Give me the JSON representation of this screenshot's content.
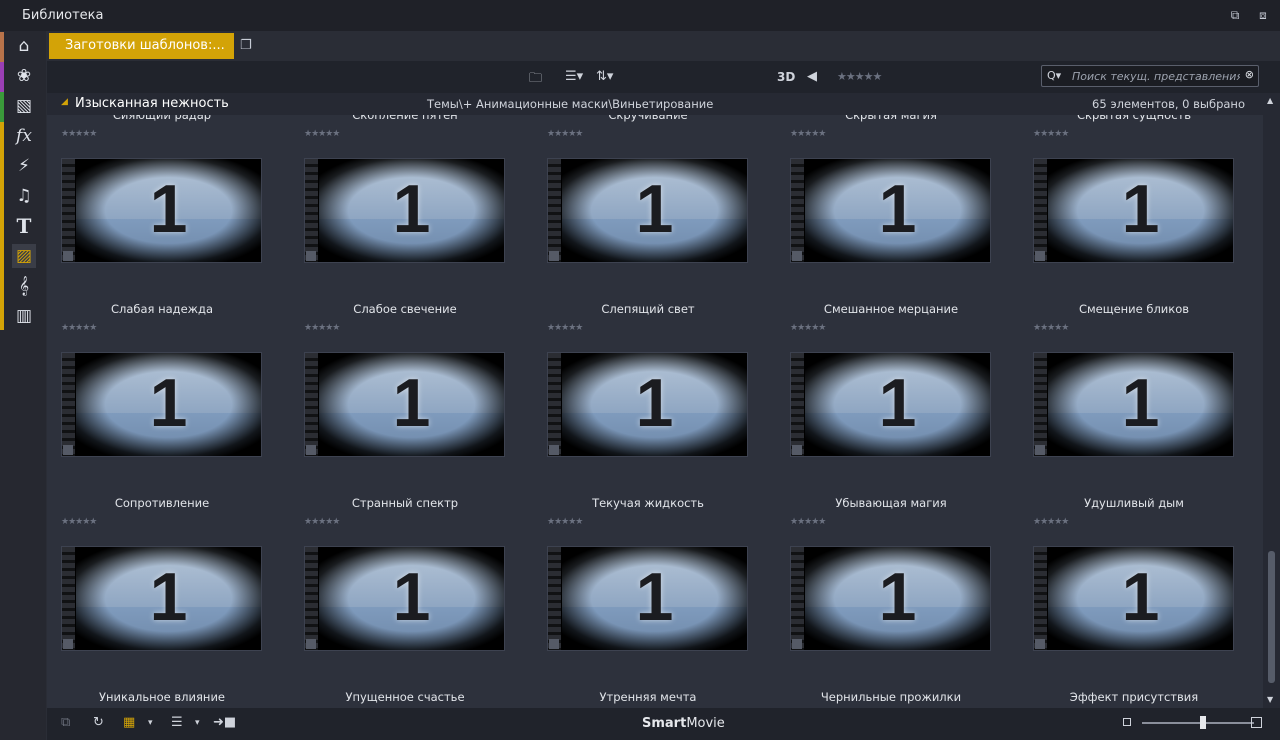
{
  "window": {
    "title": "Библиотека",
    "restore_icon": "restore-window-icon",
    "detach_icon": "detach-window-icon"
  },
  "leftbar": {
    "items": [
      {
        "icon": "project-bin-icon",
        "color": "#b8734a"
      },
      {
        "icon": "film-reel-icon",
        "color": "#9a3fb5"
      },
      {
        "icon": "transitions-icon",
        "color": "#3a9a3a"
      },
      {
        "icon": "fx-icon",
        "color": "#d3a307"
      },
      {
        "icon": "flash-icon",
        "color": "#d3a307"
      },
      {
        "icon": "music-note-icon",
        "color": "#d3a307"
      },
      {
        "icon": "title-text-icon",
        "color": "#d3a307"
      },
      {
        "icon": "montage-templates-icon",
        "color": "#d3a307"
      },
      {
        "icon": "scorefitter-icon",
        "color": "#d3a307"
      },
      {
        "icon": "piano-icon",
        "color": "#d3a307"
      }
    ]
  },
  "tabs": {
    "active_label": "Заготовки шаблонов:...",
    "active_color": "#d3a307"
  },
  "toolbar": {
    "mode_3d": "3D",
    "search_placeholder": "Поиск текущ. представления"
  },
  "header": {
    "collection": "Изысканная нежность",
    "path": "Темы\\+ Анимационные маски\\Виньетирование",
    "count": "65 элементов, 0 выбрано"
  },
  "rows": [
    {
      "top_labels": [
        "Сияющий радар",
        "Скопление пятен",
        "Скручивание",
        "Скрытая магия",
        "Скрытая сущность"
      ],
      "bottom_labels": [
        "Слабая надежда",
        "Слабое свечение",
        "Слепящий свет",
        "Смешанное мерцание",
        "Смещение бликов"
      ]
    },
    {
      "top_labels": [
        "Слабая надежда",
        "Слабое свечение",
        "Слепящий свет",
        "Смешанное мерцание",
        "Смещение бликов"
      ],
      "bottom_labels": [
        "Сопротивление",
        "Странный спектр",
        "Текучая жидкость",
        "Убывающая магия",
        "Удушливый дым"
      ]
    },
    {
      "top_labels": [
        "Сопротивление",
        "Странный спектр",
        "Текучая жидкость",
        "Убывающая магия",
        "Удушливый дым"
      ],
      "bottom_labels": [
        "Уникальное влияние",
        "Упущенное счастье",
        "Утренняя мечта",
        "Чернильные прожилки",
        "Эффект присутствия"
      ]
    }
  ],
  "thumbnail_number": "1",
  "bottombar": {
    "brand_bold": "Smart",
    "brand_rest": "Movie",
    "zoom": 0.55
  }
}
